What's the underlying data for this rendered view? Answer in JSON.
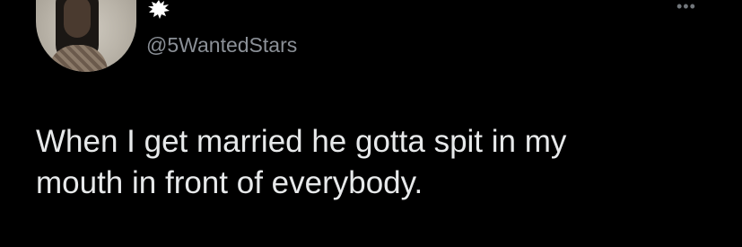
{
  "user": {
    "handle": "@5WantedStars",
    "avatar_icon": "profile-photo",
    "badge_icon": "burst-badge-icon"
  },
  "menu": {
    "more_icon": "more-options-icon",
    "glyph": "•••"
  },
  "tweet": {
    "text_lines": [
      "When I get married he gotta spit in my",
      "mouth in front of everybody."
    ]
  },
  "colors": {
    "background": "#000000",
    "text": "#e7e9ea",
    "secondary": "#8b9097"
  }
}
